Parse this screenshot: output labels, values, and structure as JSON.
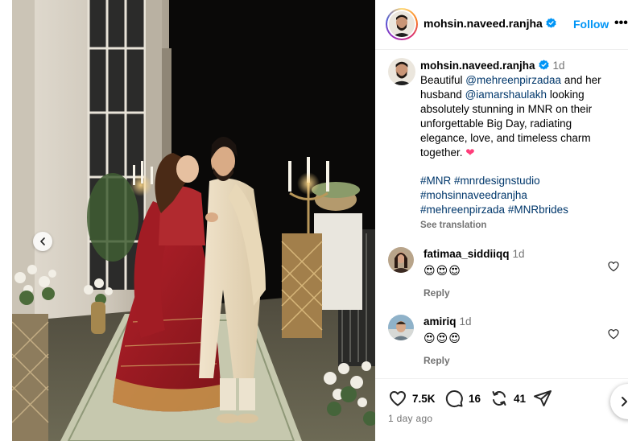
{
  "post": {
    "username": "mohsin.naveed.ranjha",
    "follow_label": "Follow",
    "more_label": "•••"
  },
  "caption": {
    "username": "mohsin.naveed.ranjha",
    "time": "1d",
    "text_1": "Beautiful ",
    "mention_1": "@mehreenpirzadaa",
    "text_2": " and her husband ",
    "mention_2": "@iamarshaulakh",
    "text_3": " looking absolutely stunning in MNR on their unforgettable Big Day, radiating elegance, love, and timeless charm together. ",
    "emoji": "❤",
    "hashtags": [
      "#MNR",
      "#mnrdesignstudio",
      "#mohsinnaveedranjha",
      "#mehreenpirzada",
      "#MNRbrides"
    ],
    "see_translation": "See translation"
  },
  "comments": [
    {
      "username": "fatimaa_siddiiqq",
      "time": "1d",
      "text": "😍😍😍",
      "reply": "Reply"
    },
    {
      "username": "amiriq",
      "time": "1d",
      "text": "😍😍😍",
      "reply": "Reply"
    }
  ],
  "actions": {
    "likes": "7.5K",
    "comments": "16",
    "reposts": "41",
    "time_ago": "1 day ago"
  },
  "icons": {
    "verified": "verified-badge-icon",
    "like": "heart-outline-icon",
    "comment": "speech-bubble-icon",
    "repost": "repost-arrows-icon",
    "share": "paper-plane-icon",
    "carousel_prev": "chevron-left-icon",
    "carousel_next": "chevron-right-icon"
  },
  "colors": {
    "link": "#00376b",
    "follow": "#0095f6",
    "verified": "#0095f6",
    "muted": "#737373"
  }
}
